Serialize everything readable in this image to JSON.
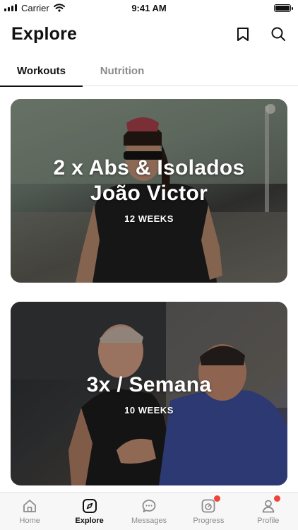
{
  "status_bar": {
    "carrier": "Carrier",
    "time": "9:41 AM"
  },
  "header": {
    "title": "Explore",
    "actions": [
      "bookmark-icon",
      "search-icon"
    ]
  },
  "tabs": [
    {
      "label": "Workouts",
      "active": true
    },
    {
      "label": "Nutrition",
      "active": false
    }
  ],
  "cards": [
    {
      "title": "2 x Abs & Isolados João Victor",
      "meta": "12  WEEKS"
    },
    {
      "title": "3x / Semana",
      "meta": "10  WEEKS"
    }
  ],
  "bottom_nav": [
    {
      "label": "Home",
      "icon": "home-icon",
      "active": false,
      "badge": false
    },
    {
      "label": "Explore",
      "icon": "compass-icon",
      "active": true,
      "badge": false
    },
    {
      "label": "Messages",
      "icon": "chat-icon",
      "active": false,
      "badge": false
    },
    {
      "label": "Progress",
      "icon": "progress-icon",
      "active": false,
      "badge": true
    },
    {
      "label": "Profile",
      "icon": "profile-icon",
      "active": false,
      "badge": true
    }
  ],
  "colors": {
    "accent": "#111111",
    "inactive": "#8b8b8b",
    "badge": "#f0443a"
  }
}
